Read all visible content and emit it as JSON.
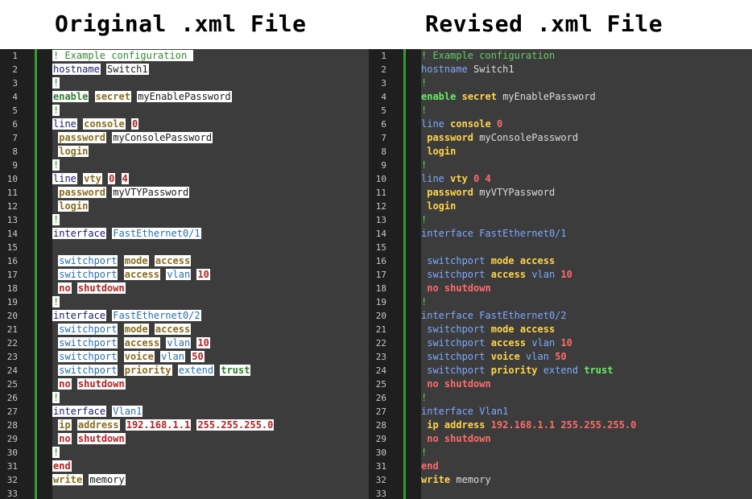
{
  "titles": {
    "left": "Original .xml File",
    "right": "Revised .xml File"
  },
  "colors": {
    "gutter_marker": "#2f9e2f",
    "left_background": "#3c3c3c",
    "right_background": "#3c3c3c"
  },
  "code_lines": [
    [
      [
        "c-comment",
        "! Example configuration "
      ]
    ],
    [
      [
        "c-key",
        "hostname"
      ],
      [
        "",
        ""
      ],
      [
        "c-str",
        "Switch1"
      ]
    ],
    [
      [
        "c-bang",
        "!"
      ]
    ],
    [
      [
        "c-green",
        "enable"
      ],
      [
        "",
        ""
      ],
      [
        "c-kw",
        "secret"
      ],
      [
        "",
        ""
      ],
      [
        "c-str",
        "myEnablePassword"
      ]
    ],
    [
      [
        "c-bang",
        "!"
      ]
    ],
    [
      [
        "c-key",
        "line"
      ],
      [
        "",
        ""
      ],
      [
        "c-kw",
        "console"
      ],
      [
        "",
        ""
      ],
      [
        "c-num",
        "0"
      ]
    ],
    [
      [
        "",
        ""
      ],
      [
        "c-kw",
        "password"
      ],
      [
        "",
        ""
      ],
      [
        "c-str",
        "myConsolePassword"
      ]
    ],
    [
      [
        "",
        ""
      ],
      [
        "c-kw",
        "login"
      ]
    ],
    [
      [
        "c-bang",
        "!"
      ]
    ],
    [
      [
        "c-key",
        "line"
      ],
      [
        "",
        ""
      ],
      [
        "c-kw",
        "vty"
      ],
      [
        "",
        ""
      ],
      [
        "c-num",
        "0"
      ],
      [
        "",
        ""
      ],
      [
        "c-num",
        "4"
      ]
    ],
    [
      [
        "",
        ""
      ],
      [
        "c-kw",
        "password"
      ],
      [
        "",
        ""
      ],
      [
        "c-str",
        "myVTYPassword"
      ]
    ],
    [
      [
        "",
        ""
      ],
      [
        "c-kw",
        "login"
      ]
    ],
    [
      [
        "c-bang",
        "!"
      ]
    ],
    [
      [
        "c-key",
        "interface"
      ],
      [
        "",
        ""
      ],
      [
        "c-iface",
        "FastEthernet0/1"
      ]
    ],
    [],
    [
      [
        "",
        ""
      ],
      [
        "c-iface",
        "switchport"
      ],
      [
        "",
        ""
      ],
      [
        "c-kw",
        "mode"
      ],
      [
        "",
        ""
      ],
      [
        "c-kw",
        "access"
      ]
    ],
    [
      [
        "",
        ""
      ],
      [
        "c-iface",
        "switchport"
      ],
      [
        "",
        ""
      ],
      [
        "c-kw",
        "access"
      ],
      [
        "",
        ""
      ],
      [
        "c-iface",
        "vlan"
      ],
      [
        "",
        ""
      ],
      [
        "c-num",
        "10"
      ]
    ],
    [
      [
        "",
        ""
      ],
      [
        "c-red",
        "no"
      ],
      [
        "",
        ""
      ],
      [
        "c-red",
        "shutdown"
      ]
    ],
    [
      [
        "c-bang",
        "!"
      ]
    ],
    [
      [
        "c-key",
        "interface"
      ],
      [
        "",
        ""
      ],
      [
        "c-iface",
        "FastEthernet0/2"
      ]
    ],
    [
      [
        "",
        ""
      ],
      [
        "c-iface",
        "switchport"
      ],
      [
        "",
        ""
      ],
      [
        "c-kw",
        "mode"
      ],
      [
        "",
        ""
      ],
      [
        "c-kw",
        "access"
      ]
    ],
    [
      [
        "",
        ""
      ],
      [
        "c-iface",
        "switchport"
      ],
      [
        "",
        ""
      ],
      [
        "c-kw",
        "access"
      ],
      [
        "",
        ""
      ],
      [
        "c-iface",
        "vlan"
      ],
      [
        "",
        ""
      ],
      [
        "c-num",
        "10"
      ]
    ],
    [
      [
        "",
        ""
      ],
      [
        "c-iface",
        "switchport"
      ],
      [
        "",
        ""
      ],
      [
        "c-kw",
        "voice"
      ],
      [
        "",
        ""
      ],
      [
        "c-iface",
        "vlan"
      ],
      [
        "",
        ""
      ],
      [
        "c-num",
        "50"
      ]
    ],
    [
      [
        "",
        ""
      ],
      [
        "c-iface",
        "switchport"
      ],
      [
        "",
        ""
      ],
      [
        "c-kw",
        "priority"
      ],
      [
        "",
        ""
      ],
      [
        "c-iface",
        "extend"
      ],
      [
        "",
        ""
      ],
      [
        "c-green",
        "trust"
      ]
    ],
    [
      [
        "",
        ""
      ],
      [
        "c-red",
        "no"
      ],
      [
        "",
        ""
      ],
      [
        "c-red",
        "shutdown"
      ]
    ],
    [
      [
        "c-bang",
        "!"
      ]
    ],
    [
      [
        "c-key",
        "interface"
      ],
      [
        "",
        ""
      ],
      [
        "c-iface",
        "Vlan1"
      ]
    ],
    [
      [
        "",
        ""
      ],
      [
        "c-kw",
        "ip"
      ],
      [
        "",
        ""
      ],
      [
        "c-kw",
        "address"
      ],
      [
        "",
        ""
      ],
      [
        "c-num",
        "192.168.1.1"
      ],
      [
        "",
        ""
      ],
      [
        "c-num",
        "255.255.255.0"
      ]
    ],
    [
      [
        "",
        ""
      ],
      [
        "c-red",
        "no"
      ],
      [
        "",
        ""
      ],
      [
        "c-red",
        "shutdown"
      ]
    ],
    [
      [
        "c-bang",
        "!"
      ]
    ],
    [
      [
        "c-red",
        "end"
      ]
    ],
    [
      [
        "c-kw",
        "write"
      ],
      [
        "",
        ""
      ],
      [
        "c-str",
        "memory"
      ]
    ],
    []
  ]
}
